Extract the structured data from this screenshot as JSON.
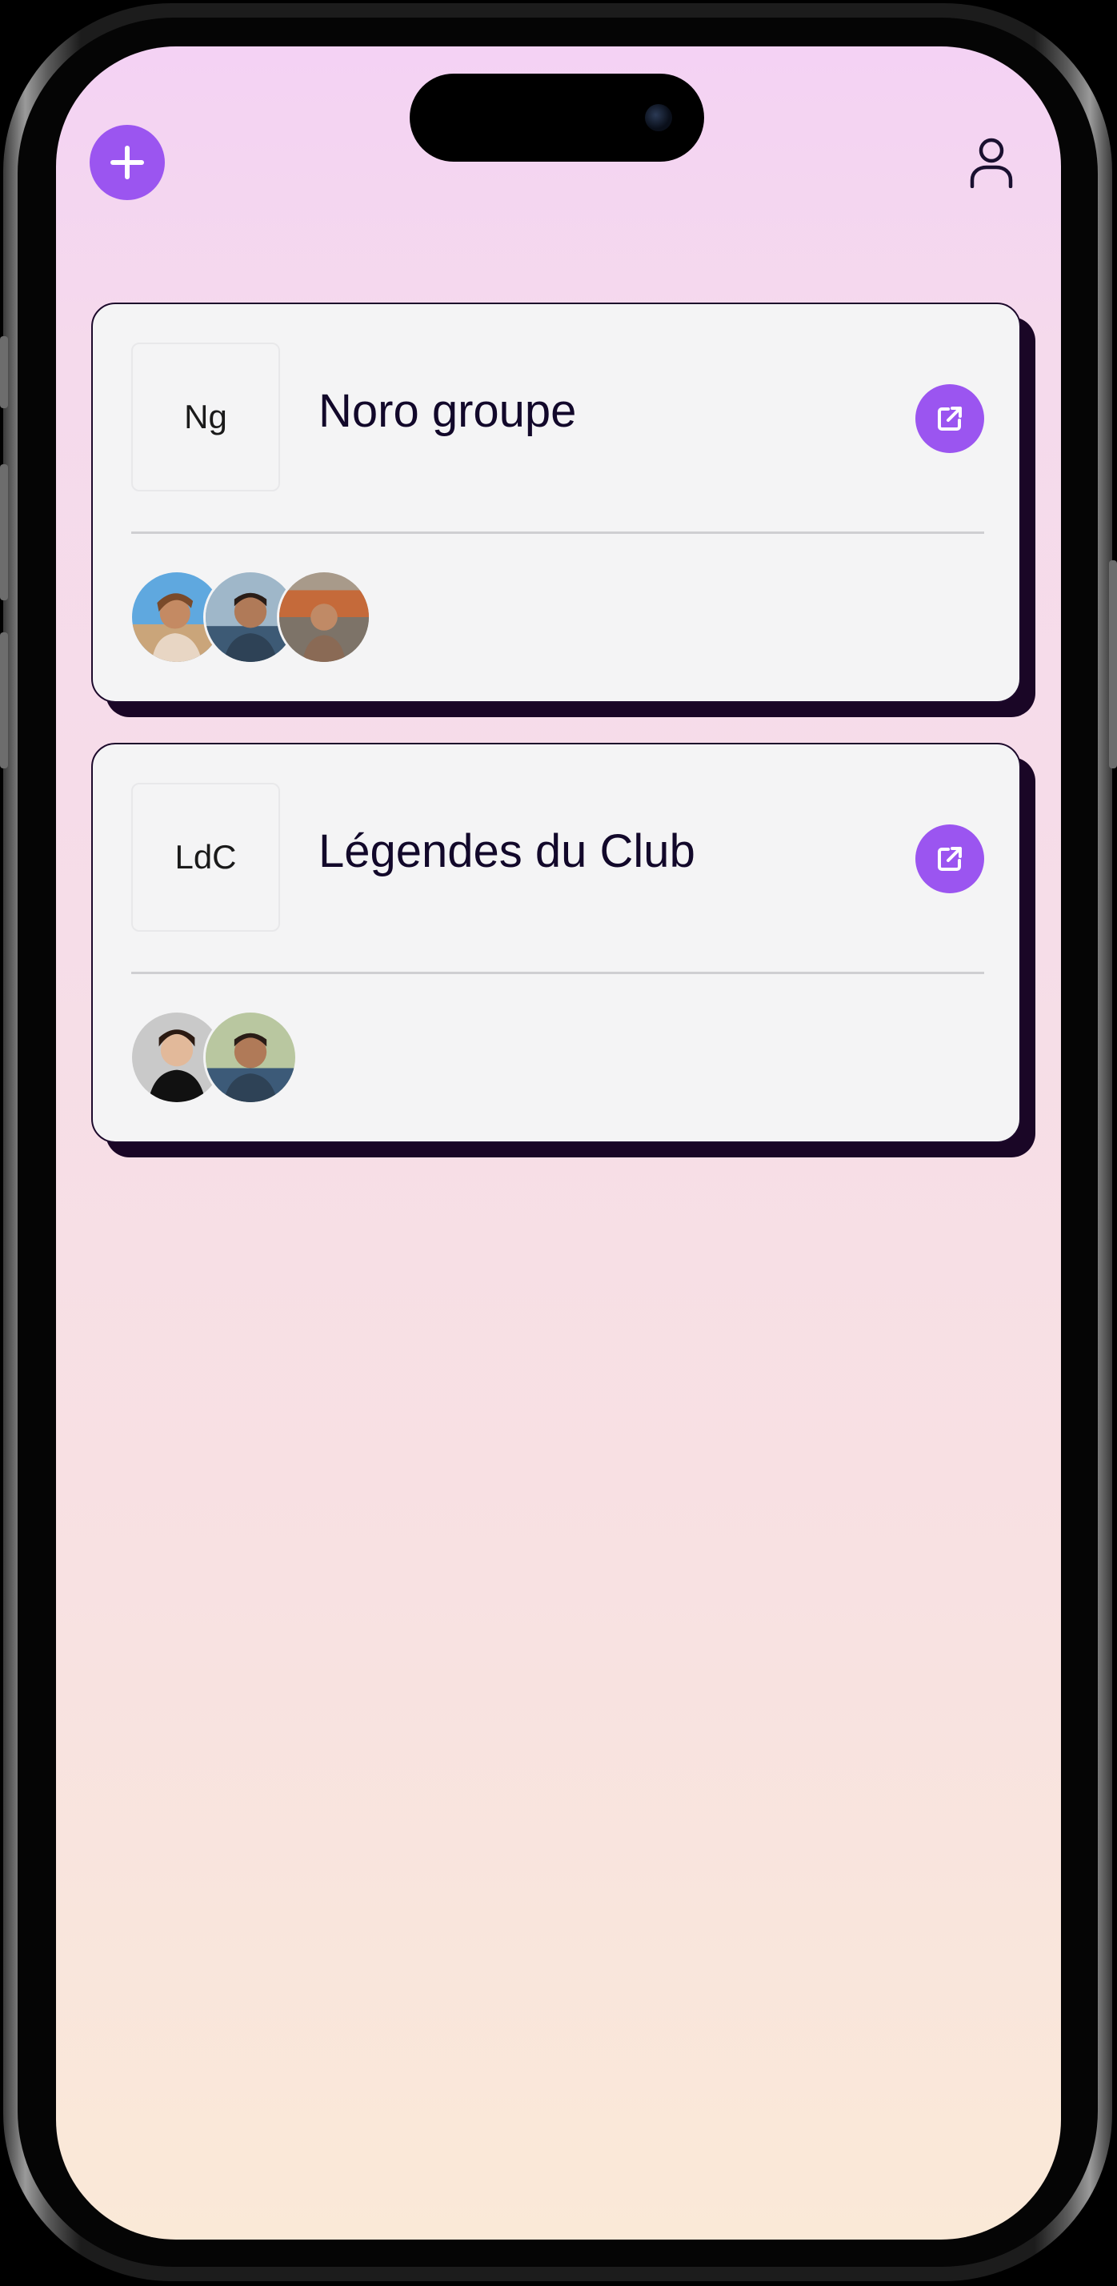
{
  "header": {
    "add_button": {
      "icon": "plus-icon",
      "color": "#9b55f0"
    },
    "profile_button": {
      "icon": "user-icon"
    }
  },
  "groups": [
    {
      "initials": "Ng",
      "name": "Noro groupe",
      "open_icon": "external-link-icon",
      "member_avatars": [
        "avatar-1",
        "avatar-2",
        "avatar-3"
      ]
    },
    {
      "initials": "LdC",
      "name": "Légendes du Club",
      "open_icon": "external-link-icon",
      "member_avatars": [
        "avatar-1",
        "avatar-2"
      ]
    }
  ],
  "colors": {
    "accent": "#9b55f0",
    "card_background": "#f4f4f5",
    "card_shadow": "#1a0626",
    "background_top": "#f4d2f4",
    "background_bottom": "#fae9d7"
  }
}
